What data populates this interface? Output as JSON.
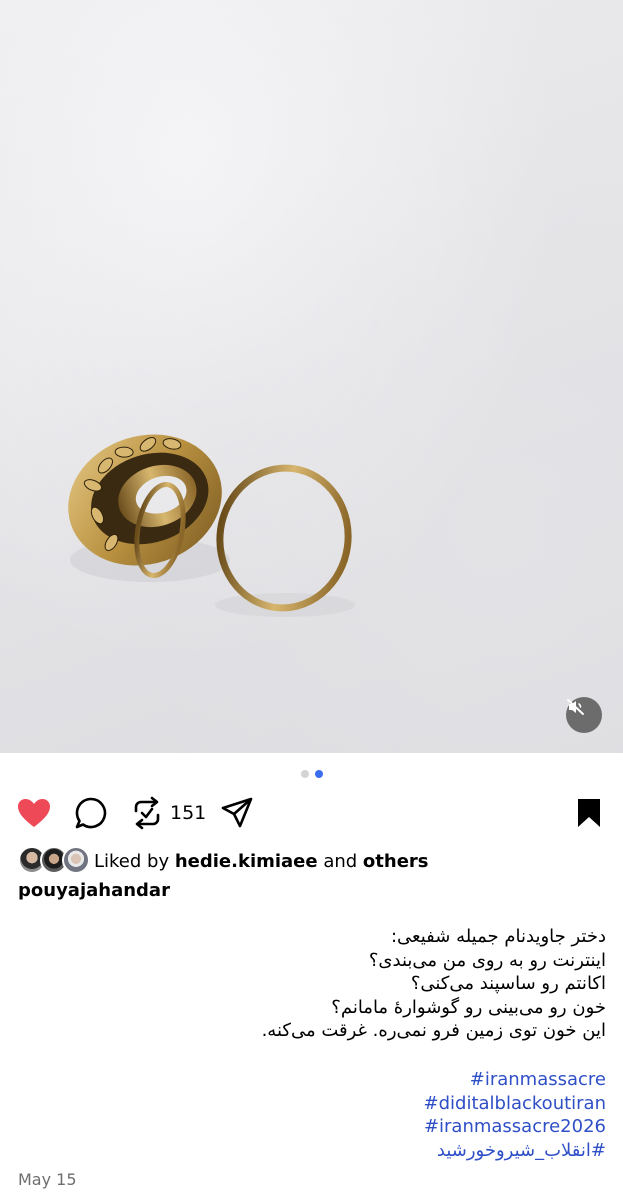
{
  "post": {
    "media_label": "Photo of two gold hoop earrings on a white towel",
    "carousel": {
      "total": 2,
      "active": 2
    },
    "mute_button_icon": "speaker-muted-icon"
  },
  "actions": {
    "like_icon": "heart-filled-icon",
    "comment_icon": "comment-bubble-icon",
    "repost_icon": "repost-icon",
    "repost_count": "151",
    "share_icon": "send-icon",
    "save_icon": "bookmark-filled-icon",
    "like_color": "#ed4956"
  },
  "likes": {
    "prefix": "Liked by ",
    "user": "hedie.kimiaee",
    "middle": " and ",
    "others": "others"
  },
  "author": {
    "username": "pouyajahandar"
  },
  "caption": {
    "lines": [
      "دختر جاویدنام جمیله شفیعی:",
      " اینترنت رو به روی من می‌بندی؟",
      "اکانتم رو ساسپند می‌کنی؟",
      "خون رو می‌بینی رو گوشوارهٔ مامانم؟",
      "این خون توی زمین فرو نمی‌ره. غرقت می‌کنه."
    ],
    "hashtags": [
      "#iranmassacre",
      "#diditalblackoutiran",
      "#iranmassacre2026",
      "#انقلاب_شیروخورشید"
    ],
    "hashtag_color": "#2f4fc7"
  },
  "meta": {
    "date": "May 15"
  }
}
